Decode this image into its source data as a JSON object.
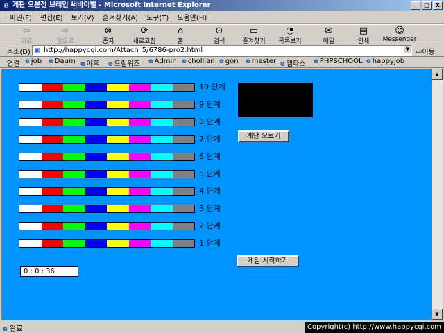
{
  "window": {
    "title": "게판 오분전 브레인 써바이벌 - Microsoft Internet Explorer",
    "minimize_label": "_",
    "maximize_label": "□",
    "close_label": "X"
  },
  "menu": [
    "파일(F)",
    "편집(E)",
    "보기(V)",
    "즐겨찾기(A)",
    "도구(T)",
    "도움말(H)"
  ],
  "toolbar": {
    "back": "뒤로",
    "forward": "앞으로",
    "stop": "중지",
    "refresh": "새로고침",
    "home": "홈",
    "search": "검색",
    "favorites": "즐겨찾기",
    "history": "목록보기",
    "mail": "메일",
    "print": "인쇄",
    "messenger": "Messenger"
  },
  "address": {
    "label": "주소(D)",
    "url": "http://happycgi.com/Attach_5/6786-pro2.html",
    "go": "이동"
  },
  "links": {
    "label": "연결",
    "items": [
      "job",
      "Daum",
      "야후",
      "드림위즈",
      "Admin",
      "chollian",
      "gon",
      "master",
      "엠파스",
      "PHPSCHOOL",
      "happyjob"
    ]
  },
  "colors": {
    "content_bg": "#0094ff",
    "bar_segments": [
      "#ffffff",
      "#ff0000",
      "#00ff00",
      "#0000ff",
      "#ffff00",
      "#ff00ff",
      "#00ffff",
      "#808080"
    ]
  },
  "levels": [
    "10 단계",
    "9 단계",
    "8 단계",
    "7 단계",
    "6 단계",
    "5 단계",
    "4 단계",
    "3 단계",
    "2 단계",
    "1 단계"
  ],
  "game": {
    "climb_button": "계단 오르기",
    "start_button": "게임 시작하기",
    "timer": "0 : 0 : 36"
  },
  "status": {
    "text": "완료",
    "copyright": "Copyright(c) http://www.happycgi.com"
  }
}
